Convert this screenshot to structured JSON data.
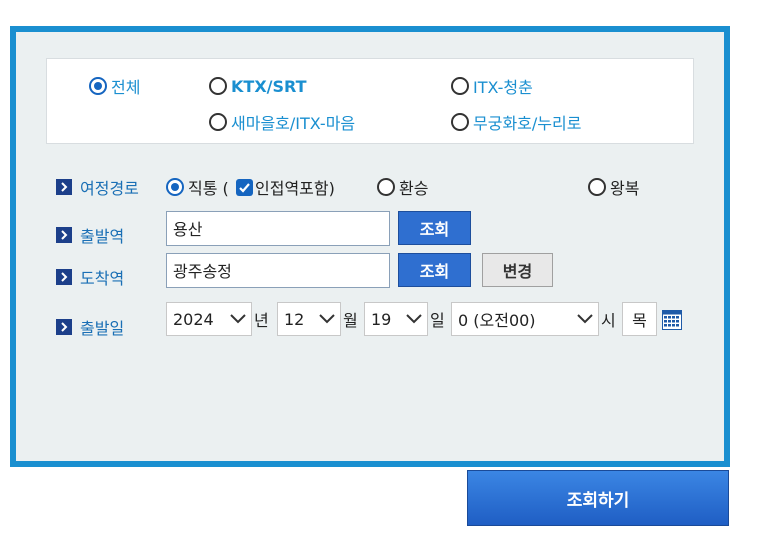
{
  "train_types": {
    "all": "전체",
    "ktx_srt": "KTX/SRT",
    "itx_cheongchun": "ITX-청춘",
    "saemaeul_itx_maum": "새마을호/ITX-마음",
    "mugunghwa_nuriro": "무궁화호/누리로"
  },
  "route": {
    "label": "여정경로",
    "direct": "직통 (",
    "adjacent": "인접역포함)",
    "transfer": "환승",
    "roundtrip": "왕복"
  },
  "departure": {
    "label": "출발역",
    "value": "용산",
    "search_label": "조회"
  },
  "arrival": {
    "label": "도착역",
    "value": "광주송정",
    "search_label": "조회",
    "swap_label": "변경"
  },
  "date": {
    "label": "출발일",
    "year": "2024",
    "year_unit": "년",
    "month": "12",
    "month_unit": "월",
    "day": "19",
    "day_unit": "일",
    "hour": "0 (오전00)",
    "hour_unit": "시",
    "weekday": "목"
  },
  "submit_label": "조회하기",
  "colors": {
    "border": "#1a8fd0",
    "panel_bg": "#ebf0f1",
    "link": "#1a8fd0",
    "button": "#2f6fd0"
  }
}
